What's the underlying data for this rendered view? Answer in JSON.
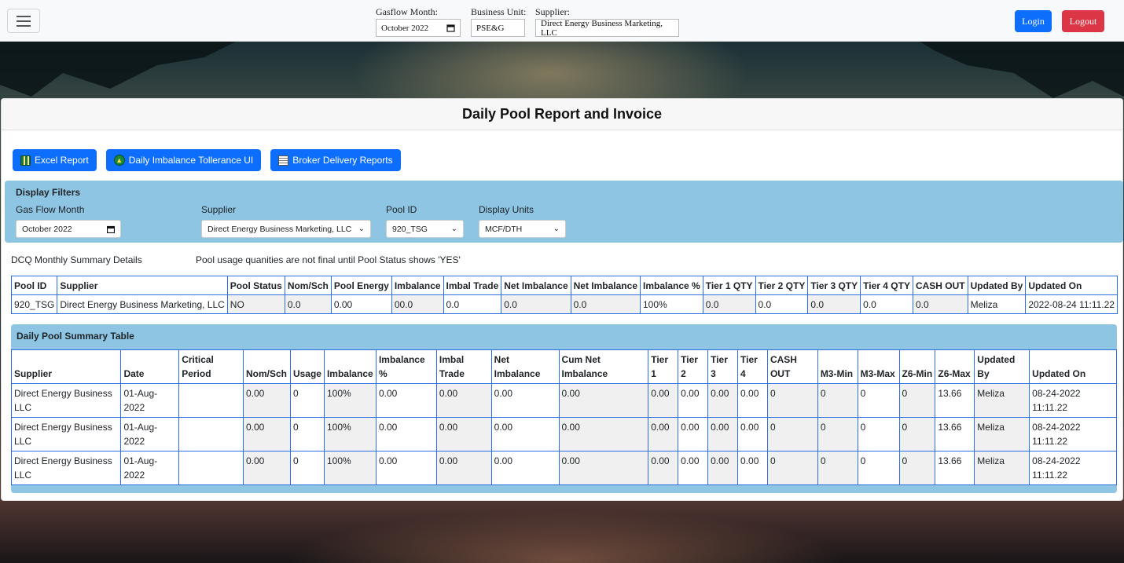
{
  "nav": {
    "gasflow_label": "Gasflow Month:",
    "gasflow_value": "October 2022",
    "bu_label": "Business Unit:",
    "bu_value": "PSE&G",
    "supplier_label": "Supplier:",
    "supplier_value": "Direct Energy Business Marketing, LLC",
    "login": "Login",
    "logout": "Logout"
  },
  "card": {
    "title": "Daily Pool Report and Invoice",
    "buttons": {
      "excel": "Excel Report",
      "imbalance": "Daily Imbalance Tollerance UI",
      "broker": "Broker Delivery Reports"
    }
  },
  "filters": {
    "title": "Display Filters",
    "gas_flow_label": "Gas Flow Month",
    "gas_flow_value": "October 2022",
    "supplier_label": "Supplier",
    "supplier_value": "Direct Energy Business Marketing, LLC",
    "pool_label": "Pool ID",
    "pool_value": "920_TSG",
    "units_label": "Display Units",
    "units_value": "MCF/DTH"
  },
  "summary": {
    "left": "DCQ Monthly Summary Details",
    "note": "Pool usage quanities are not final until Pool Status shows 'YES'"
  },
  "top_table": {
    "headers": [
      "Pool ID",
      "Supplier",
      "Pool Status",
      "Nom/Sch",
      "Pool Energy",
      "Imbalance",
      "Imbal Trade",
      "Net Imbalance",
      "Net Imbalance",
      "Imbalance %",
      "Tier 1 QTY",
      "Tier 2 QTY",
      "Tier 3 QTY",
      "Tier 4 QTY",
      "CASH OUT",
      "Updated By",
      "Updated On"
    ],
    "row": [
      "920_TSG",
      "Direct Energy Business Marketing, LLC",
      "NO",
      "0.0",
      "0.00",
      "00.0",
      "0.0",
      "0.0",
      "0.0",
      "100%",
      "0.0",
      "0.0",
      "0.0",
      "0.0",
      "0.0",
      "Meliza",
      "2022-08-24 11:11.22"
    ]
  },
  "daily": {
    "title": "Daily Pool Summary Table",
    "headers": [
      "Supplier",
      "Date",
      "Critical Period",
      "Nom/Sch",
      "Usage",
      "Imbalance",
      "Imbalance %",
      "Imbal Trade",
      "Net Imbalance",
      "Cum Net Imbalance",
      "Tier 1",
      "Tier 2",
      "Tier 3",
      "Tier 4",
      "CASH OUT",
      "M3-Min",
      "M3-Max",
      "Z6-Min",
      "Z6-Max",
      "Updated By",
      "Updated On"
    ],
    "rows": [
      [
        "Direct Energy Business LLC",
        "01-Aug-2022",
        "",
        "0.00",
        "0",
        "100%",
        "0.00",
        "0.00",
        "0.00",
        "0.00",
        "0.00",
        "0.00",
        "0.00",
        "0.00",
        "0",
        "0",
        "0",
        "0",
        "13.66",
        "Meliza",
        "08-24-2022 11:11.22"
      ],
      [
        "Direct Energy Business LLC",
        "01-Aug-2022",
        "",
        "0.00",
        "0",
        "100%",
        "0.00",
        "0.00",
        "0.00",
        "0.00",
        "0.00",
        "0.00",
        "0.00",
        "0.00",
        "0",
        "0",
        "0",
        "0",
        "13.66",
        "Meliza",
        "08-24-2022 11:11.22"
      ],
      [
        "Direct Energy Business LLC",
        "01-Aug-2022",
        "",
        "0.00",
        "0",
        "100%",
        "0.00",
        "0.00",
        "0.00",
        "0.00",
        "0.00",
        "0.00",
        "0.00",
        "0.00",
        "0",
        "0",
        "0",
        "0",
        "13.66",
        "Meliza",
        "08-24-2022 11:11.22"
      ]
    ]
  }
}
